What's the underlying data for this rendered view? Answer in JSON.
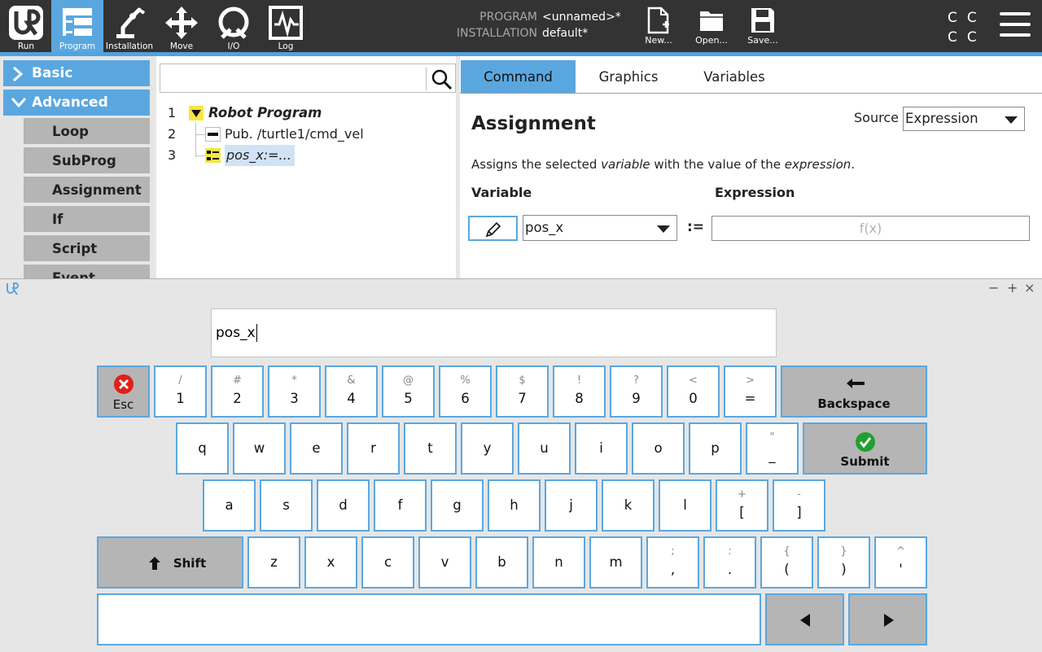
{
  "topbar": {
    "nav": [
      {
        "label": "Run",
        "icon": "ur-logo-icon"
      },
      {
        "label": "Program",
        "icon": "program-tree-icon"
      },
      {
        "label": "Installation",
        "icon": "robot-arm-icon"
      },
      {
        "label": "Move",
        "icon": "move-arrows-icon"
      },
      {
        "label": "I/O",
        "icon": "io-icon"
      },
      {
        "label": "Log",
        "icon": "log-chart-icon"
      }
    ],
    "program_label": "PROGRAM",
    "program_value": "<unnamed>*",
    "installation_label": "INSTALLATION",
    "installation_value": "default*",
    "file": {
      "new": "New...",
      "open": "Open...",
      "save": "Save..."
    },
    "cc": [
      "C",
      "C",
      "C",
      "C"
    ]
  },
  "left_menu": {
    "basic": "Basic",
    "advanced": "Advanced",
    "items": [
      "Loop",
      "SubProg",
      "Assignment",
      "If",
      "Script",
      "Event"
    ]
  },
  "tree": {
    "rows": [
      {
        "num": "1",
        "text": "Robot Program"
      },
      {
        "num": "2",
        "text": "Pub. /turtle1/cmd_vel"
      },
      {
        "num": "3",
        "text": "pos_x:=..."
      }
    ]
  },
  "command": {
    "tabs": [
      "Command",
      "Graphics",
      "Variables"
    ],
    "title": "Assignment",
    "source_label": "Source",
    "source_value": "Expression",
    "desc_1": "Assigns the selected ",
    "desc_var": "variable",
    "desc_2": " with the value of the ",
    "desc_expr": "expression",
    "desc_3": ".",
    "variable_label": "Variable",
    "expression_label": "Expression",
    "variable_value": "pos_x",
    "operator": ":=",
    "expression_placeholder": "f(x)"
  },
  "keyboard": {
    "window_controls": [
      "−",
      "+",
      "×"
    ],
    "input_value": "pos_x",
    "esc": "Esc",
    "backspace": "Backspace",
    "submit": "Submit",
    "shift": "Shift",
    "row1": [
      {
        "alt": "/",
        "main": "1"
      },
      {
        "alt": "#",
        "main": "2"
      },
      {
        "alt": "*",
        "main": "3"
      },
      {
        "alt": "&",
        "main": "4"
      },
      {
        "alt": "@",
        "main": "5"
      },
      {
        "alt": "%",
        "main": "6"
      },
      {
        "alt": "$",
        "main": "7"
      },
      {
        "alt": "!",
        "main": "8"
      },
      {
        "alt": "?",
        "main": "9"
      },
      {
        "alt": "<",
        "main": "0"
      },
      {
        "alt": ">",
        "main": "="
      }
    ],
    "row2": [
      "q",
      "w",
      "e",
      "r",
      "t",
      "y",
      "u",
      "i",
      "o",
      "p"
    ],
    "row2_extra": {
      "alt": "\"",
      "main": "_"
    },
    "row3": [
      "a",
      "s",
      "d",
      "f",
      "g",
      "h",
      "j",
      "k",
      "l"
    ],
    "row3_extra": [
      {
        "alt": "+",
        "main": "["
      },
      {
        "alt": "-",
        "main": "]"
      }
    ],
    "row4": [
      "z",
      "x",
      "c",
      "v",
      "b",
      "n",
      "m"
    ],
    "row4_extra": [
      {
        "alt": ";",
        "main": ","
      },
      {
        "alt": ":",
        "main": "."
      },
      {
        "alt": "{",
        "main": "("
      },
      {
        "alt": "}",
        "main": ")"
      },
      {
        "alt": "^",
        "main": "'"
      }
    ]
  },
  "colors": {
    "accent": "#5aa7e0",
    "topbar": "#333333",
    "key_gray": "#b5b5b5"
  }
}
